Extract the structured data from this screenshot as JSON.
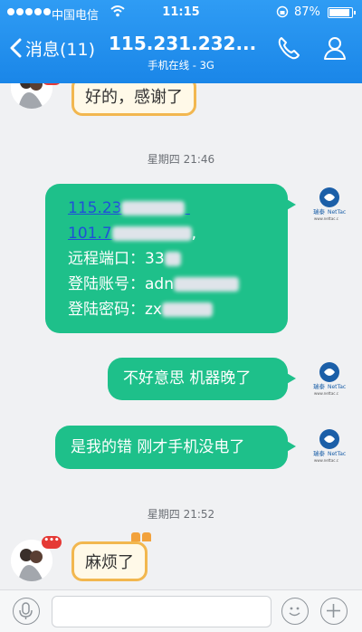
{
  "status_bar": {
    "carrier": "中国电信",
    "time": "11:15",
    "battery": "87%",
    "battery_level": 0.87
  },
  "header": {
    "back_label": "消息(11)",
    "title": "115.231.232...",
    "subtitle": "手机在线 - 3G",
    "call_icon": "phone-icon",
    "profile_icon": "person-icon"
  },
  "colors": {
    "header_blue": "#1a86e8",
    "outgoing_bubble": "#1ec08a",
    "incoming_bubble_border": "#f2b74f",
    "link_blue": "#1f4fd8"
  },
  "messages": [
    {
      "direction": "in",
      "text": "好的，感谢了"
    },
    {
      "timestamp": "星期四 21:46"
    },
    {
      "direction": "out",
      "lines": [
        {
          "text": "115.23"
        },
        {
          "text": "101.7",
          "suffix": ","
        },
        {
          "label": "远程端口：",
          "value": "33"
        },
        {
          "label": "登陆账号：",
          "value": "adn"
        },
        {
          "label": "登陆密码：",
          "value": "zx"
        }
      ]
    },
    {
      "direction": "out",
      "text": "不好意思 机器晚了"
    },
    {
      "direction": "out",
      "text": "是我的错 刚才手机没电了"
    },
    {
      "timestamp": "星期四 21:52"
    },
    {
      "direction": "in",
      "text": "麻烦了"
    }
  ],
  "sender_logo": {
    "brand": "瑞泰",
    "name": "NetTac",
    "url": "www.nettac.c"
  },
  "input_bar": {
    "placeholder": "",
    "voice_icon": "microphone-icon",
    "emoji_icon": "smiley-icon",
    "more_icon": "plus-icon"
  }
}
